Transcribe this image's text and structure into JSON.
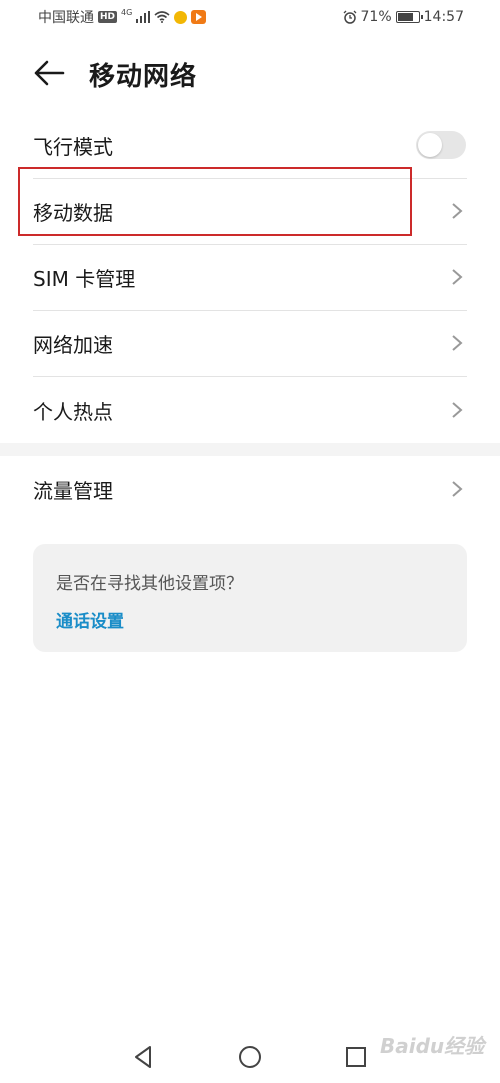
{
  "status_bar": {
    "carrier": "中国联通",
    "hd": "HD",
    "network": "4G",
    "battery_percent": "71%",
    "battery_level": 0.71,
    "time": "14:57"
  },
  "header": {
    "title": "移动网络"
  },
  "list": {
    "airplane_mode": {
      "label": "飞行模式",
      "enabled": false
    },
    "items": [
      {
        "label": "移动数据"
      },
      {
        "label": "SIM 卡管理"
      },
      {
        "label": "网络加速"
      },
      {
        "label": "个人热点"
      }
    ],
    "traffic": {
      "label": "流量管理"
    }
  },
  "suggestion": {
    "question": "是否在寻找其他设置项？",
    "link": "通话设置"
  },
  "watermark": "Baidu经验",
  "colors": {
    "highlight": "#cc2a2a",
    "link": "#1a8dc8",
    "card_bg": "#f1f1f1",
    "divider": "#e3e3e3"
  }
}
